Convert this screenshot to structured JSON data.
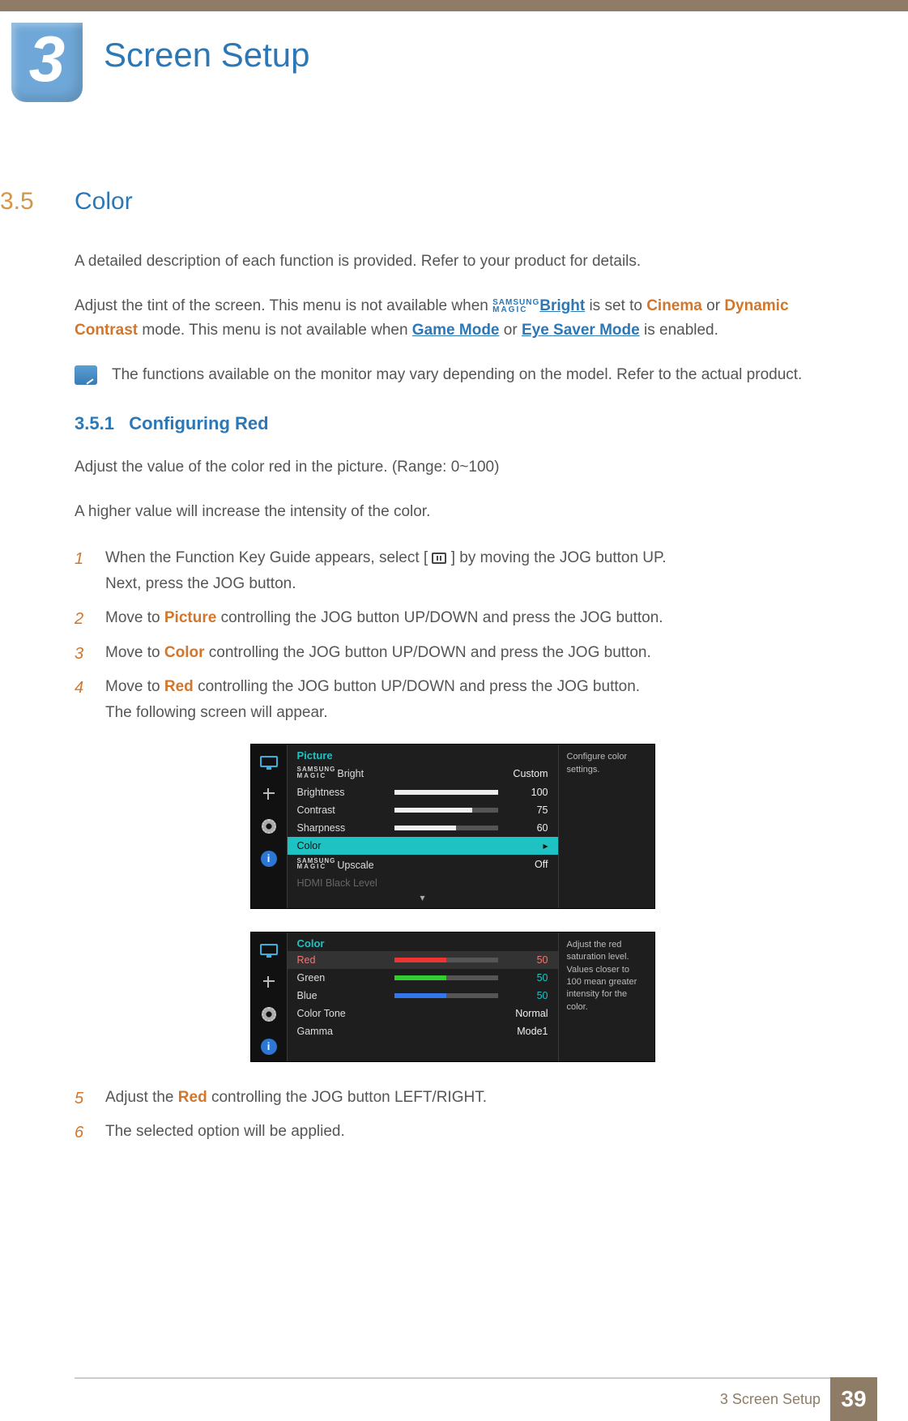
{
  "chapter": {
    "number": "3",
    "title": "Screen Setup"
  },
  "section": {
    "number": "3.5",
    "title": "Color"
  },
  "intro": {
    "p1": "A detailed description of each function is provided. Refer to your product for details.",
    "p2a": "Adjust the tint of the screen. This menu is not available when ",
    "magic_top": "SAMSUNG",
    "magic_bot": "MAGIC",
    "bright_link": "Bright",
    "p2b": " is set to ",
    "cinema": "Cinema",
    "p2c": " or ",
    "dyncon": "Dynamic Contrast",
    "p2d": " mode. This menu is not available when ",
    "game": "Game Mode",
    "p2e": " or ",
    "eye": "Eye Saver Mode",
    "p2f": " is enabled.",
    "note": "The functions available on the monitor may vary depending on the model. Refer to the actual product."
  },
  "subsection": {
    "number": "3.5.1",
    "title": "Configuring Red"
  },
  "desc": {
    "p1": "Adjust the value of the color red in the picture. (Range: 0~100)",
    "p2": "A higher value will increase the intensity of the color."
  },
  "steps": {
    "s1a": "When the Function Key Guide appears, select [",
    "s1b": "] by moving the JOG button UP.",
    "s1c": "Next, press the JOG button.",
    "s2a": "Move to ",
    "s2_picture": "Picture",
    "s2b": " controlling the JOG button UP/DOWN and press the JOG button.",
    "s3a": "Move to ",
    "s3_color": "Color",
    "s3b": " controlling the JOG button UP/DOWN and press the JOG button.",
    "s4a": "Move to ",
    "s4_red": "Red",
    "s4b": " controlling the JOG button UP/DOWN and press the JOG button.",
    "s4c": "The following screen will appear.",
    "s5a": "Adjust the ",
    "s5_red": "Red",
    "s5b": " controlling the JOG button LEFT/RIGHT.",
    "s6": "The selected option will be applied."
  },
  "osd1": {
    "header": "Picture",
    "tip": "Configure color settings.",
    "rows": {
      "bright_label": "Bright",
      "bright_val": "Custom",
      "brightness": "Brightness",
      "brightness_val": "100",
      "contrast": "Contrast",
      "contrast_val": "75",
      "sharpness": "Sharpness",
      "sharpness_val": "60",
      "color": "Color",
      "upscale_label": "Upscale",
      "upscale_val": "Off",
      "hdmi": "HDMI Black Level"
    }
  },
  "osd2": {
    "header": "Color",
    "tip": "Adjust the red saturation level. Values closer to 100 mean greater intensity for the color.",
    "rows": {
      "red": "Red",
      "red_val": "50",
      "green": "Green",
      "green_val": "50",
      "blue": "Blue",
      "blue_val": "50",
      "tone": "Color Tone",
      "tone_val": "Normal",
      "gamma": "Gamma",
      "gamma_val": "Mode1"
    }
  },
  "footer": {
    "text": "3 Screen Setup",
    "page": "39"
  },
  "step_nums": {
    "n1": "1",
    "n2": "2",
    "n3": "3",
    "n4": "4",
    "n5": "5",
    "n6": "6"
  },
  "icons": {
    "info_glyph": "i",
    "more_glyph": "▾",
    "arrow_glyph": "▸"
  }
}
